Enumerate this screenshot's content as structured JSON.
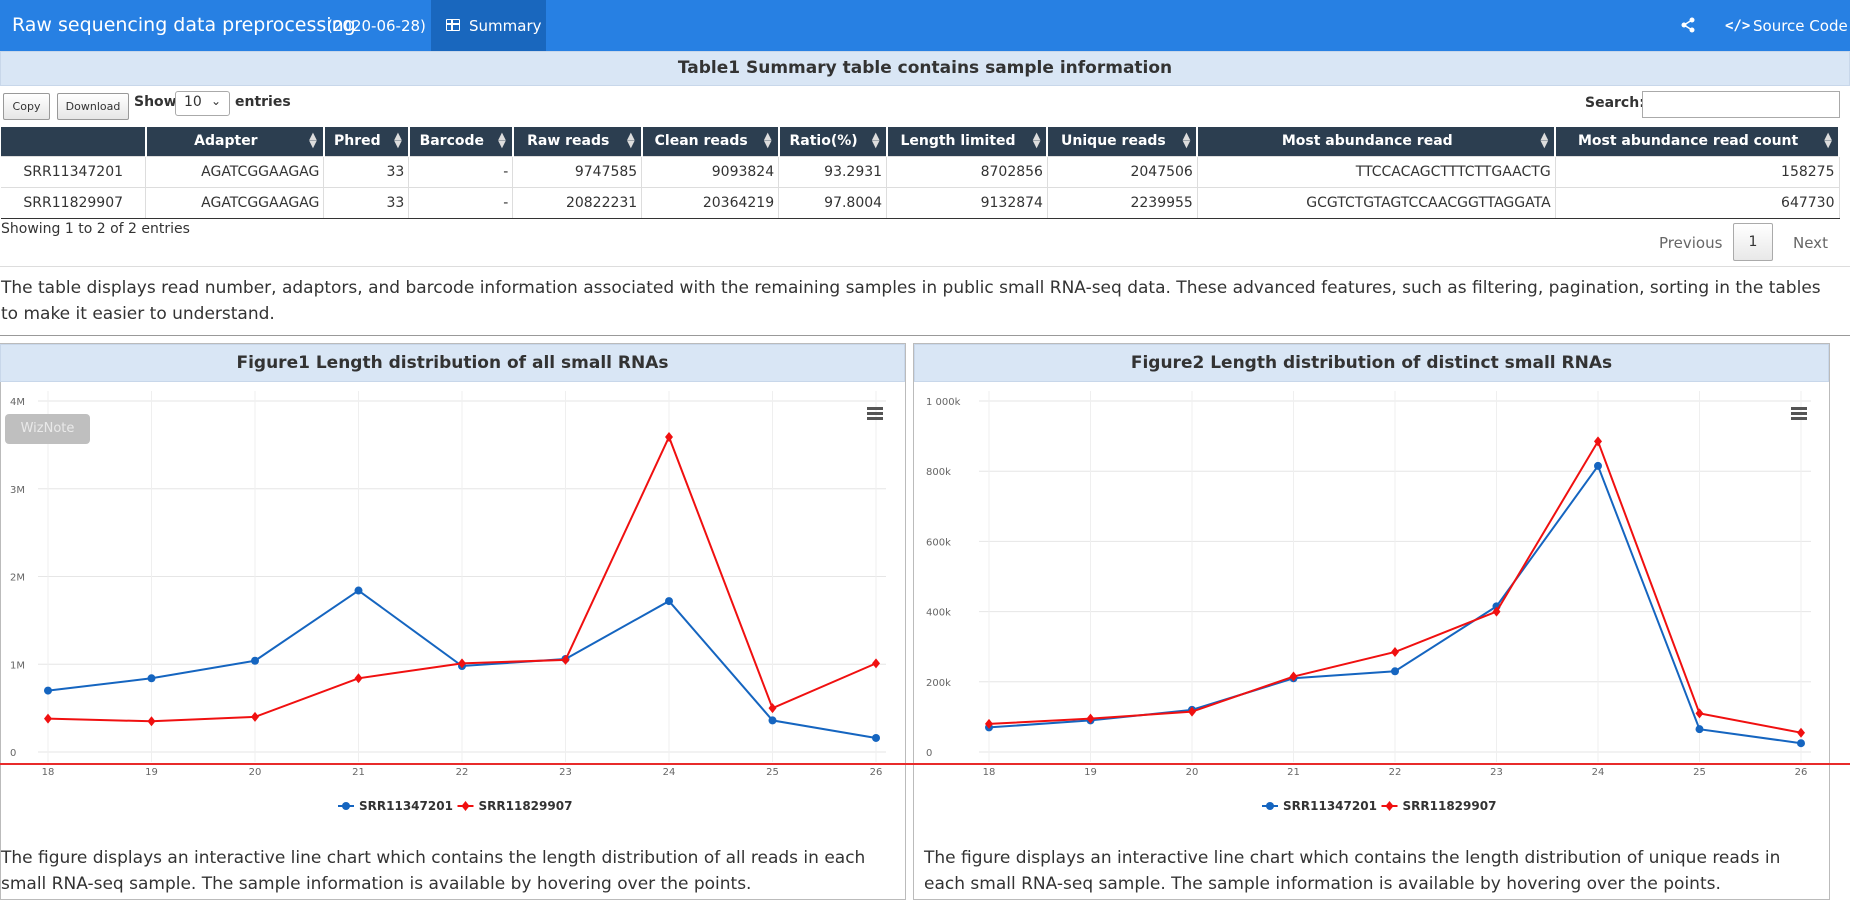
{
  "navbar": {
    "title": "Raw sequencing data preprocessing",
    "date": "(2020-06-28)",
    "tab_label": "Summary",
    "source_code_label": "Source Code"
  },
  "table_section": {
    "title": "Table1 Summary table contains sample information",
    "copy_label": "Copy",
    "download_label": "Download",
    "show_label": "Show",
    "entries_value": "10",
    "entries_label": "entries",
    "search_label": "Search:",
    "search_value": "",
    "columns": [
      "",
      "Adapter",
      "Phred",
      "Barcode",
      "Raw reads",
      "Clean reads",
      "Ratio(%)",
      "Length limited",
      "Unique reads",
      "Most abundance read",
      "Most abundance read count"
    ],
    "rows": [
      [
        "SRR11347201",
        "AGATCGGAAGAG",
        "33",
        "-",
        "9747585",
        "9093824",
        "93.2931",
        "8702856",
        "2047506",
        "TTCCACAGCTTTCTTGAACTG",
        "158275"
      ],
      [
        "SRR11829907",
        "AGATCGGAAGAG",
        "33",
        "-",
        "20822231",
        "20364219",
        "97.8004",
        "9132874",
        "2239955",
        "GCGTCTGTAGTCCAACGGTTAGGATA",
        "647730"
      ]
    ],
    "info": "Showing 1 to 2 of 2 entries",
    "pagination": {
      "previous": "Previous",
      "current": "1",
      "next": "Next"
    },
    "description": "The table displays read number, adaptors, and barcode information associated with the remaining samples in public small RNA-seq data. These advanced features, such as filtering, pagination, sorting in the tables to make it easier to understand."
  },
  "figure1": {
    "title": "Figure1 Length distribution of all small RNAs",
    "watermark": "WizNote",
    "description": "The figure displays an interactive line chart which contains the length distribution of all reads in each small RNA-seq sample. The sample information is available by hovering over the points."
  },
  "figure2": {
    "title": "Figure2 Length distribution of distinct small RNAs",
    "description": "The figure displays an interactive line chart which contains the length distribution of unique reads in each small RNA-seq sample. The sample information is available by hovering over the points."
  },
  "colors": {
    "navbar": "#2780e3",
    "series1": "#1565c0",
    "series2": "#f01010"
  },
  "chart_data": [
    {
      "type": "line",
      "title": "Figure1 Length distribution of all small RNAs",
      "x": [
        "18",
        "19",
        "20",
        "21",
        "22",
        "23",
        "24",
        "25",
        "26"
      ],
      "ylim": [
        0,
        4000000
      ],
      "yticks": [
        "0",
        "1M",
        "2M",
        "3M",
        "4M"
      ],
      "series": [
        {
          "name": "SRR11347201",
          "color": "#1565c0",
          "marker": "circle",
          "values": [
            700000,
            840000,
            1040000,
            1840000,
            980000,
            1060000,
            1720000,
            360000,
            160000
          ]
        },
        {
          "name": "SRR11829907",
          "color": "#f01010",
          "marker": "diamond",
          "values": [
            380000,
            350000,
            400000,
            840000,
            1010000,
            1050000,
            3590000,
            500000,
            1010000
          ]
        }
      ],
      "grid": true,
      "legend": "bottom"
    },
    {
      "type": "line",
      "title": "Figure2 Length distribution of distinct small RNAs",
      "x": [
        "18",
        "19",
        "20",
        "21",
        "22",
        "23",
        "24",
        "25",
        "26"
      ],
      "ylim": [
        0,
        1000000
      ],
      "yticks": [
        "0",
        "200k",
        "400k",
        "600k",
        "800k",
        "1 000k"
      ],
      "series": [
        {
          "name": "SRR11347201",
          "color": "#1565c0",
          "marker": "circle",
          "values": [
            70000,
            90000,
            120000,
            210000,
            230000,
            415000,
            815000,
            65000,
            25000
          ]
        },
        {
          "name": "SRR11829907",
          "color": "#f01010",
          "marker": "diamond",
          "values": [
            80000,
            95000,
            115000,
            215000,
            285000,
            400000,
            885000,
            110000,
            55000
          ]
        }
      ],
      "grid": true,
      "legend": "bottom"
    }
  ]
}
